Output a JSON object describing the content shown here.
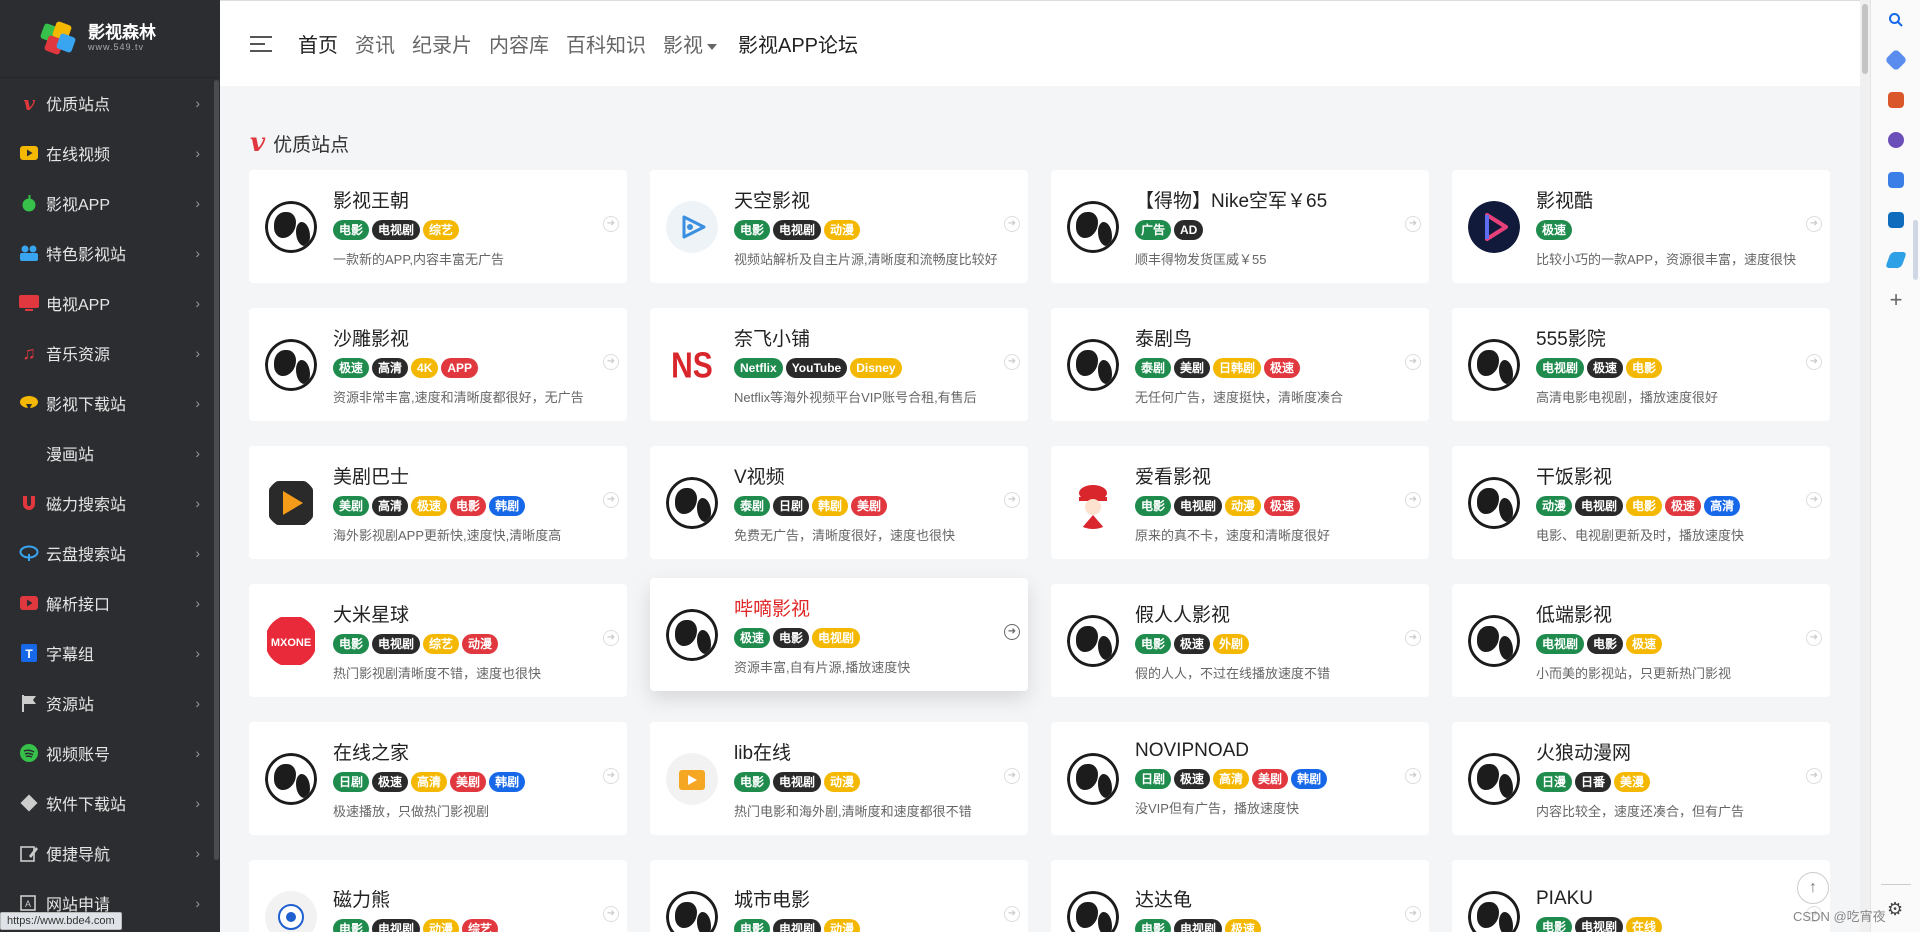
{
  "brand": {
    "name": "影视森林",
    "url": "www.549.tv"
  },
  "status_url": "https://www.bde4.com",
  "sidebar": {
    "items": [
      {
        "label": "优质站点",
        "icon": "vimeo-icon",
        "color": "#e0383e"
      },
      {
        "label": "在线视频",
        "icon": "youtube-icon",
        "color": "#f5b800"
      },
      {
        "label": "影视APP",
        "icon": "apple-icon",
        "color": "#37c14a"
      },
      {
        "label": "特色影视站",
        "icon": "users-icon",
        "color": "#39a4f0"
      },
      {
        "label": "电视APP",
        "icon": "tv-icon",
        "color": "#e0383e"
      },
      {
        "label": "音乐资源",
        "icon": "music-icon",
        "color": "#e0383e"
      },
      {
        "label": "影视下载站",
        "icon": "cloud-download-icon",
        "color": "#f5b800"
      },
      {
        "label": "漫画站",
        "icon": "",
        "color": ""
      },
      {
        "label": "磁力搜索站",
        "icon": "magnet-icon",
        "color": "#e0383e"
      },
      {
        "label": "云盘搜索站",
        "icon": "cloud-search-icon",
        "color": "#39a4f0"
      },
      {
        "label": "解析接口",
        "icon": "youtube-icon",
        "color": "#e0383e"
      },
      {
        "label": "字幕组",
        "icon": "t-icon",
        "color": "#1768e8"
      },
      {
        "label": "资源站",
        "icon": "flag-icon",
        "color": "#cccccc"
      },
      {
        "label": "视频账号",
        "icon": "spotify-icon",
        "color": "#37c14a"
      },
      {
        "label": "软件下载站",
        "icon": "diamond-icon",
        "color": "#cccccc"
      },
      {
        "label": "便捷导航",
        "icon": "edit-icon",
        "color": "#cccccc"
      },
      {
        "label": "网站申请",
        "icon": "apply-icon",
        "color": "#cccccc"
      }
    ]
  },
  "topnav": {
    "items": [
      "首页",
      "资讯",
      "纪录片",
      "内容库",
      "百科知识",
      "影视"
    ],
    "forum": "影视APP论坛"
  },
  "section": {
    "title": "优质站点"
  },
  "cards": [
    {
      "name": "影视王朝",
      "icon": "globe",
      "tags": [
        [
          "电影",
          "green"
        ],
        [
          "电视剧",
          "dark"
        ],
        [
          "综艺",
          "yellow"
        ]
      ],
      "desc": "一款新的APP,内容丰富无广告"
    },
    {
      "name": "天空影视",
      "icon": "play-blue",
      "tags": [
        [
          "电影",
          "green"
        ],
        [
          "电视剧",
          "dark"
        ],
        [
          "动漫",
          "yellow"
        ]
      ],
      "desc": "视频站解析及自主片源,清晰度和流畅度比较好"
    },
    {
      "name": "【得物】Nike空军￥65",
      "icon": "globe",
      "tags": [
        [
          "广告",
          "green"
        ],
        [
          "AD",
          "dark"
        ]
      ],
      "desc": "顺丰得物发货匡威￥55"
    },
    {
      "name": "影视酷",
      "icon": "play-gradient",
      "tags": [
        [
          "极速",
          "green"
        ]
      ],
      "desc": "比较小巧的一款APP，资源很丰富，速度很快"
    },
    {
      "name": "沙雕影视",
      "icon": "globe",
      "tags": [
        [
          "极速",
          "green"
        ],
        [
          "高清",
          "dark"
        ],
        [
          "4K",
          "yellow"
        ],
        [
          "APP",
          "red"
        ]
      ],
      "desc": "资源非常丰富,速度和清晰度都很好，无广告"
    },
    {
      "name": "奈飞小铺",
      "icon": "ns",
      "tags": [
        [
          "Netflix",
          "green"
        ],
        [
          "YouTube",
          "dark"
        ],
        [
          "Disney",
          "yellow"
        ]
      ],
      "desc": "Netflix等海外视频平台VIP账号合租,有售后"
    },
    {
      "name": "泰剧鸟",
      "icon": "globe",
      "tags": [
        [
          "泰剧",
          "green"
        ],
        [
          "美剧",
          "dark"
        ],
        [
          "日韩剧",
          "yellow"
        ],
        [
          "极速",
          "red"
        ]
      ],
      "desc": "无任何广告，速度挺快，清晰度凑合"
    },
    {
      "name": "555影院",
      "icon": "globe",
      "tags": [
        [
          "电视剧",
          "green"
        ],
        [
          "极速",
          "dark"
        ],
        [
          "电影",
          "yellow"
        ]
      ],
      "desc": "高清电影电视剧，播放速度很好"
    },
    {
      "name": "美剧巴士",
      "icon": "play-orange",
      "tags": [
        [
          "美剧",
          "green"
        ],
        [
          "高清",
          "dark"
        ],
        [
          "极速",
          "yellow"
        ],
        [
          "电影",
          "red"
        ],
        [
          "韩剧",
          "blue"
        ]
      ],
      "desc": "海外影视剧APP更新快,速度快,清晰度高"
    },
    {
      "name": "V视频",
      "icon": "globe",
      "tags": [
        [
          "泰剧",
          "green"
        ],
        [
          "日剧",
          "dark"
        ],
        [
          "韩剧",
          "yellow"
        ],
        [
          "美剧",
          "red"
        ]
      ],
      "desc": "免费无广告，清晰度很好，速度也很快"
    },
    {
      "name": "爱看影视",
      "icon": "spy",
      "tags": [
        [
          "电影",
          "green"
        ],
        [
          "电视剧",
          "dark"
        ],
        [
          "动漫",
          "yellow"
        ],
        [
          "极速",
          "red"
        ]
      ],
      "desc": "原来的真不卡，速度和清晰度很好"
    },
    {
      "name": "干饭影视",
      "icon": "globe",
      "tags": [
        [
          "动漫",
          "green"
        ],
        [
          "电视剧",
          "dark"
        ],
        [
          "电影",
          "yellow"
        ],
        [
          "极速",
          "red"
        ],
        [
          "高清",
          "blue"
        ]
      ],
      "desc": "电影、电视剧更新及时，播放速度快"
    },
    {
      "name": "大米星球",
      "icon": "mxone",
      "tags": [
        [
          "电影",
          "green"
        ],
        [
          "电视剧",
          "dark"
        ],
        [
          "综艺",
          "yellow"
        ],
        [
          "动漫",
          "red"
        ]
      ],
      "desc": "热门影视剧清晰度不错，速度也很快"
    },
    {
      "name": "哔嘀影视",
      "icon": "globe",
      "highlight": true,
      "tags": [
        [
          "极速",
          "green"
        ],
        [
          "电影",
          "dark"
        ],
        [
          "电视剧",
          "yellow"
        ]
      ],
      "desc": "资源丰富,自有片源,播放速度快"
    },
    {
      "name": "假人人影视",
      "icon": "globe",
      "tags": [
        [
          "电影",
          "green"
        ],
        [
          "极速",
          "dark"
        ],
        [
          "外剧",
          "yellow"
        ]
      ],
      "desc": "假的人人，不过在线播放速度不错"
    },
    {
      "name": "低端影视",
      "icon": "globe",
      "tags": [
        [
          "电视剧",
          "green"
        ],
        [
          "电影",
          "dark"
        ],
        [
          "极速",
          "yellow"
        ]
      ],
      "desc": "小而美的影视站，只更新热门影视"
    },
    {
      "name": "在线之家",
      "icon": "globe",
      "tags": [
        [
          "日剧",
          "green"
        ],
        [
          "极速",
          "dark"
        ],
        [
          "高清",
          "yellow"
        ],
        [
          "美剧",
          "red"
        ],
        [
          "韩剧",
          "blue"
        ]
      ],
      "desc": "极速播放，只做热门影视剧"
    },
    {
      "name": "lib在线",
      "icon": "tv-orange",
      "tags": [
        [
          "电影",
          "green"
        ],
        [
          "电视剧",
          "dark"
        ],
        [
          "动漫",
          "yellow"
        ]
      ],
      "desc": "热门电影和海外剧,清晰度和速度都很不错"
    },
    {
      "name": "NOVIPNOAD",
      "icon": "globe",
      "tags": [
        [
          "日剧",
          "green"
        ],
        [
          "极速",
          "dark"
        ],
        [
          "高清",
          "yellow"
        ],
        [
          "美剧",
          "red"
        ],
        [
          "韩剧",
          "blue"
        ]
      ],
      "desc": "没VIP但有广告，播放速度快"
    },
    {
      "name": "火狼动漫网",
      "icon": "globe",
      "tags": [
        [
          "日漫",
          "green"
        ],
        [
          "日番",
          "dark"
        ],
        [
          "美漫",
          "yellow"
        ]
      ],
      "desc": "内容比较全，速度还凑合，但有广告"
    },
    {
      "name": "磁力熊",
      "icon": "bear",
      "tags": [
        [
          "电影",
          "green"
        ],
        [
          "电视剧",
          "dark"
        ],
        [
          "动漫",
          "yellow"
        ],
        [
          "综艺",
          "red"
        ]
      ],
      "desc": ""
    },
    {
      "name": "城市电影",
      "icon": "globe",
      "tags": [
        [
          "电影",
          "green"
        ],
        [
          "电视剧",
          "dark"
        ],
        [
          "动漫",
          "yellow"
        ]
      ],
      "desc": ""
    },
    {
      "name": "达达龟",
      "icon": "globe",
      "tags": [
        [
          "电影",
          "green"
        ],
        [
          "电视剧",
          "dark"
        ],
        [
          "极速",
          "yellow"
        ]
      ],
      "desc": ""
    },
    {
      "name": "PIAKU",
      "icon": "globe",
      "tags": [
        [
          "电影",
          "green"
        ],
        [
          "电视剧",
          "dark"
        ],
        [
          "在线",
          "yellow"
        ]
      ],
      "desc": ""
    }
  ],
  "footer": {
    "watermark": "CSDN @吃宵夜"
  }
}
